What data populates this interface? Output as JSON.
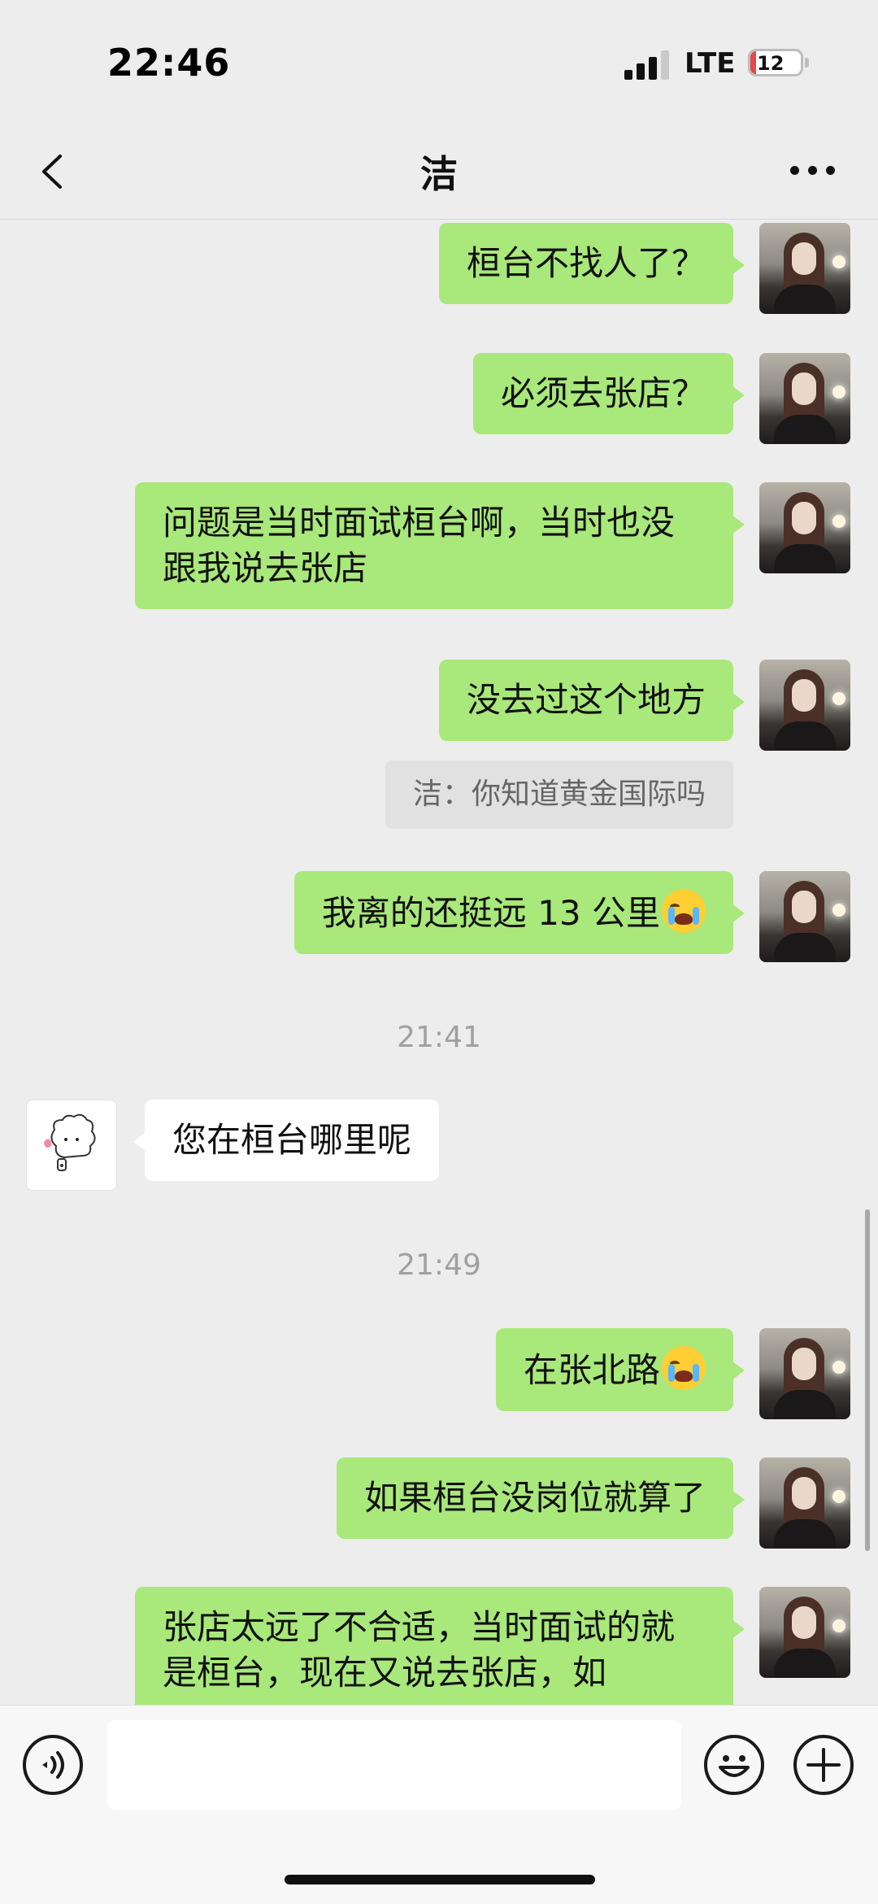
{
  "status_bar": {
    "time": "22:46",
    "network": "LTE",
    "battery": "12",
    "battery_level": 0.12
  },
  "header": {
    "title": "洁"
  },
  "messages": [
    {
      "from": "me",
      "text": "桓台不找人了？"
    },
    {
      "from": "me",
      "text": "必须去张店？"
    },
    {
      "from": "me",
      "text": "问题是当时面试桓台啊，当时也没跟我说去张店"
    },
    {
      "from": "me",
      "text": "没去过这个地方",
      "quote": "洁：你知道黄金国际吗"
    },
    {
      "from": "me",
      "text": "我离的还挺远 13 公里",
      "emoji": "crying-face"
    },
    {
      "type": "time",
      "text": "21:41"
    },
    {
      "from": "other",
      "text": "您在桓台哪里呢"
    },
    {
      "type": "time",
      "text": "21:49"
    },
    {
      "from": "me",
      "text": "在张北路",
      "emoji": "crying-face"
    },
    {
      "from": "me",
      "text": "如果桓台没岗位就算了"
    },
    {
      "from": "me",
      "text": "张店太远了不合适，当时面试的就是桓台，现在又说去张店，如"
    }
  ],
  "input_bar": {
    "value": "",
    "placeholder": ""
  },
  "colors": {
    "bubble_me": "#a9e87a",
    "bubble_other": "#ffffff",
    "background": "#ededed"
  }
}
